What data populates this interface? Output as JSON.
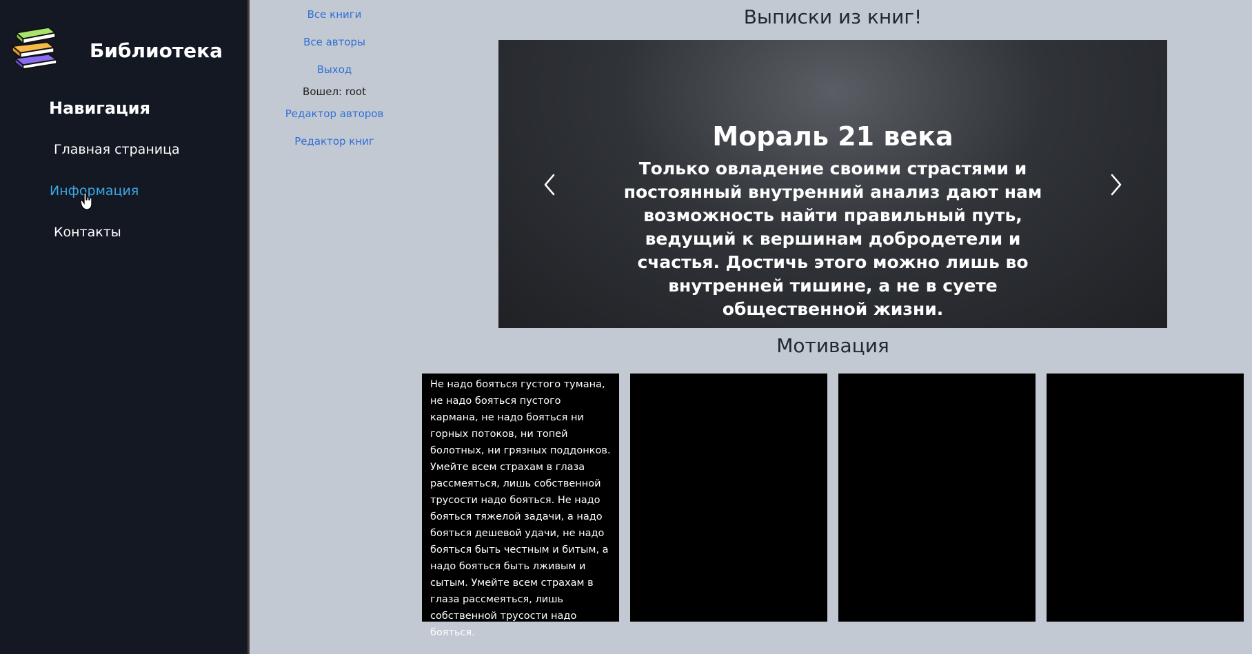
{
  "sidebar": {
    "brand": "Библиотека",
    "nav_title": "Навигация",
    "items": [
      {
        "label": "Главная страница"
      },
      {
        "label": "Информация"
      },
      {
        "label": "Контакты"
      }
    ]
  },
  "top_links": {
    "all_books": "Все книги",
    "all_authors": "Все авторы",
    "logout": "Выход",
    "logged_in": "Вошел: root",
    "author_editor": "Редактор авторов",
    "book_editor": "Редактор книг"
  },
  "main": {
    "title": "Выписки из книг!",
    "carousel": {
      "title": "Мораль 21 века",
      "text": "Только овладение своими страстями и постоянный внутренний анализ дают нам возможность найти правильный путь, ведущий к вершинам добродетели и счастья. Достичь этого можно лишь во внутренней тишине, а не в суете общественной жизни."
    },
    "section_title": "Мотивация",
    "cards": [
      {
        "text": "Не надо бояться густого тумана, не надо бояться пустого кармана, не надо бояться ни горных потоков, ни топей болотных, ни грязных поддонков. Умейте всем страхам в глаза рассмеяться, лишь собственной трусости надо бояться. Не надо бояться тяжелой задачи, а надо бояться дешевой удачи, не надо бояться быть честным и битым, а надо бояться быть лживым и сытым. Умейте всем страхам в глаза рассмеяться, лишь собственной трусости надо бояться."
      },
      {
        "text": ""
      },
      {
        "text": ""
      },
      {
        "text": ""
      }
    ]
  },
  "colors": {
    "sidebar_bg": "#141822",
    "page_bg": "#c3c9d3",
    "link": "#2f6fd6",
    "active_nav": "#3aa7e8"
  },
  "icons": {
    "logo": "books-stack-icon",
    "cursor": "hand-pointer-icon",
    "prev": "chevron-left-icon",
    "next": "chevron-right-icon"
  }
}
